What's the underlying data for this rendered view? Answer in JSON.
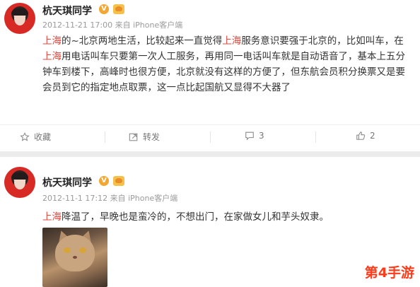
{
  "posts": [
    {
      "author": "杭天琪同学",
      "verified_mark": "V",
      "meta": "2012-11-21 17:00 来自 iPhone客户端",
      "content": [
        {
          "text": "上海",
          "hl": true
        },
        {
          "text": "的~北京两地生活，比较起来一直觉得",
          "hl": false
        },
        {
          "text": "上海",
          "hl": true
        },
        {
          "text": "服务意识要强于北京的，比如叫车，在",
          "hl": false
        },
        {
          "text": "上海",
          "hl": true
        },
        {
          "text": "用电话叫车只要第一次人工服务，再用同一电话叫车就是自动语音了，基本上五分钟车到楼下，高峰时也很方便，北京就没有这样的方便了，但东航会员积分换票又是要会员到它的指定地点取票，这一点比起国航又显得不大器了",
          "hl": false
        }
      ],
      "actions": {
        "favorite": "收藏",
        "forward": "转发",
        "comment_count": "3",
        "like_count": "2"
      }
    },
    {
      "author": "杭天琪同学",
      "verified_mark": "V",
      "meta": "2012-11-1 17:12 来自 iPhone客户端",
      "content": [
        {
          "text": "上海",
          "hl": true
        },
        {
          "text": "降温了，早晚也是蛮冷的，不想出门，在家做女儿和芋头奴隶。",
          "hl": false
        }
      ]
    }
  ],
  "watermark": "第4手游",
  "colors": {
    "highlight": "#e8453c",
    "meta": "#9a9a9a",
    "vip_gold": "#f3a632"
  },
  "icons": [
    "star-icon",
    "forward-icon",
    "comment-icon",
    "thumbs-up-icon"
  ]
}
